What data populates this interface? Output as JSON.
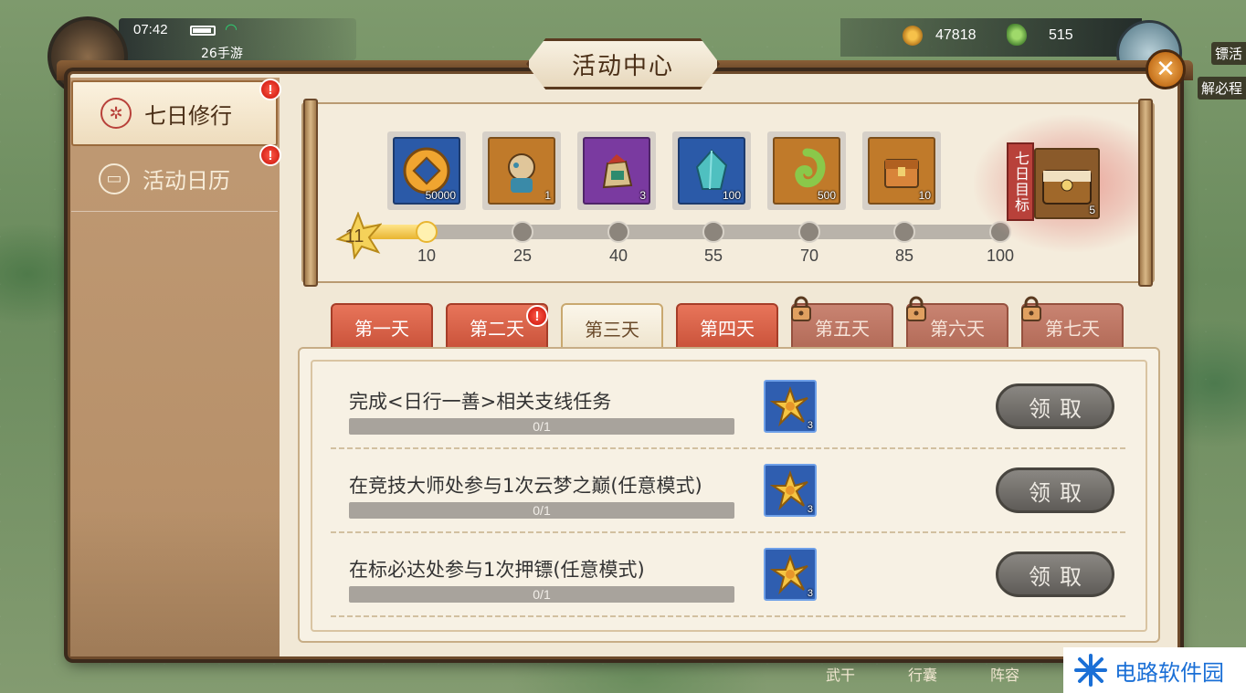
{
  "status": {
    "time": "07:42",
    "server": "26手游"
  },
  "currency": {
    "coins": "47818",
    "jade": "515"
  },
  "side_tags": {
    "top": "镖活",
    "second": "解必程"
  },
  "panel": {
    "title": "活动中心",
    "close_symbol": "✕"
  },
  "sidebar": {
    "items": [
      {
        "label": "七日修行",
        "icon": "seven-day-icon",
        "glyph": "✲",
        "active": true,
        "alert": "!"
      },
      {
        "label": "活动日历",
        "icon": "calendar-icon",
        "glyph": "▭",
        "active": false,
        "alert": "!"
      }
    ]
  },
  "track": {
    "score": "11",
    "progress_value": 11,
    "progress_max": 100,
    "milestones": [
      "10",
      "25",
      "40",
      "55",
      "70",
      "85",
      "100"
    ],
    "rewards": [
      {
        "icon": "coin-reward-icon",
        "qty": "50000",
        "color": "#2b5aa8"
      },
      {
        "icon": "warrior-reward-icon",
        "qty": "1",
        "color": "#c07a2a"
      },
      {
        "icon": "bag-reward-icon",
        "qty": "3",
        "color": "#7a3aa0"
      },
      {
        "icon": "crystal-reward-icon",
        "qty": "100",
        "color": "#2b5aa8"
      },
      {
        "icon": "jade-reward-icon",
        "qty": "500",
        "color": "#c07a2a"
      },
      {
        "icon": "chest-reward-icon",
        "qty": "10",
        "color": "#c07a2a"
      }
    ],
    "goal_label": "七日目标",
    "goal_qty": "5"
  },
  "days": [
    {
      "label": "第一天",
      "state": "open",
      "alert": false
    },
    {
      "label": "第二天",
      "state": "open",
      "alert": true
    },
    {
      "label": "第三天",
      "state": "current",
      "alert": false
    },
    {
      "label": "第四天",
      "state": "open",
      "alert": false
    },
    {
      "label": "第五天",
      "state": "locked",
      "alert": false
    },
    {
      "label": "第六天",
      "state": "locked",
      "alert": false
    },
    {
      "label": "第七天",
      "state": "locked",
      "alert": false
    }
  ],
  "tasks": [
    {
      "title": "完成<日行一善>相关支线任务",
      "progress": "0/1",
      "reward_qty": "3",
      "button": "领取"
    },
    {
      "title": "在竞技大师处参与1次云梦之巅(任意模式)",
      "progress": "0/1",
      "reward_qty": "3",
      "button": "领取"
    },
    {
      "title": "在标必达处参与1次押镖(任意模式)",
      "progress": "0/1",
      "reward_qty": "3",
      "button": "领取"
    }
  ],
  "bottom_nav": [
    "武干",
    "行囊",
    "阵容"
  ],
  "watermark": "电路软件园",
  "colors": {
    "accent": "#b8413a",
    "panel_bg": "#f1e8d6",
    "frame": "#6d4a2b",
    "tab_red": "#d9634a"
  }
}
